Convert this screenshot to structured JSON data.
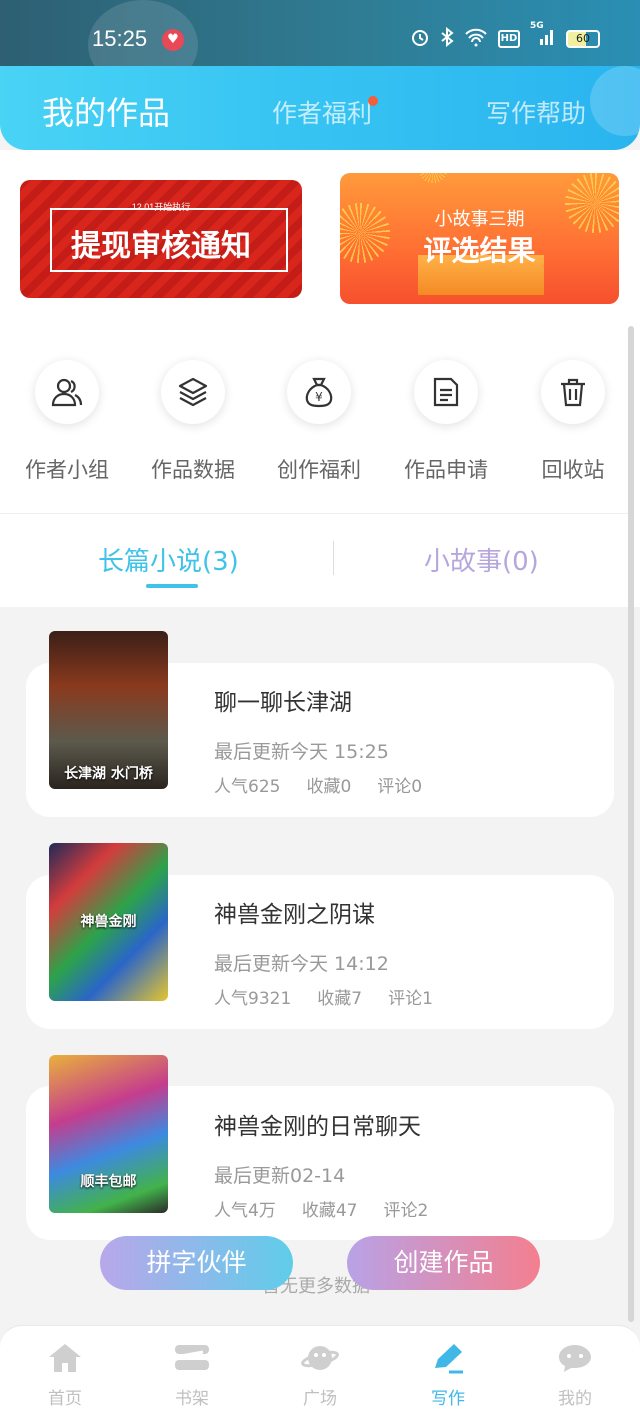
{
  "status_bar": {
    "time": "15:25",
    "battery": "60",
    "hd": "HD",
    "network": "5G"
  },
  "header": {
    "tabs": [
      {
        "label": "我的作品",
        "active": true
      },
      {
        "label": "作者福利",
        "active": false,
        "has_dot": true
      },
      {
        "label": "写作帮助",
        "active": false
      }
    ]
  },
  "banners": [
    {
      "small": "12.01开始执行",
      "text": "提现审核通知"
    },
    {
      "small": "小故事三期",
      "text": "评选结果"
    }
  ],
  "quick_actions": [
    {
      "label": "作者小组",
      "icon": "author-group-icon"
    },
    {
      "label": "作品数据",
      "icon": "layers-icon"
    },
    {
      "label": "创作福利",
      "icon": "money-bag-icon"
    },
    {
      "label": "作品申请",
      "icon": "document-icon"
    },
    {
      "label": "回收站",
      "icon": "trash-icon"
    }
  ],
  "work_tabs": [
    {
      "label": "长篇小说(3)",
      "active": true
    },
    {
      "label": "小故事(0)",
      "active": false
    }
  ],
  "works": [
    {
      "title": "聊一聊长津湖",
      "updated": "最后更新今天 15:25",
      "popularity": "人气625",
      "favorites": "收藏0",
      "comments": "评论0",
      "cover_text": "长津湖 水门桥"
    },
    {
      "title": "神兽金刚之阴谋",
      "updated": "最后更新今天 14:12",
      "popularity": "人气9321",
      "favorites": "收藏7",
      "comments": "评论1",
      "cover_text": "神兽金刚"
    },
    {
      "title": "神兽金刚的日常聊天",
      "updated": "最后更新02-14",
      "popularity": "人气4万",
      "favorites": "收藏47",
      "comments": "评论2",
      "cover_text": "顺丰包邮"
    }
  ],
  "list_footer": "暂无更多数据",
  "floating_buttons": {
    "partner": "拼字伙伴",
    "create": "创建作品"
  },
  "bottom_nav": [
    {
      "label": "首页",
      "icon": "home-icon",
      "active": false
    },
    {
      "label": "书架",
      "icon": "bookshelf-icon",
      "active": false
    },
    {
      "label": "广场",
      "icon": "planet-icon",
      "active": false
    },
    {
      "label": "写作",
      "icon": "pen-icon",
      "active": true
    },
    {
      "label": "我的",
      "icon": "profile-chat-icon",
      "active": false
    }
  ],
  "colors": {
    "accent": "#3fc3e8",
    "header_start": "#49d3f5",
    "header_end": "#2ab4ef",
    "inactive_tab": "#b5a6dd",
    "red_dot": "#f0603a"
  }
}
